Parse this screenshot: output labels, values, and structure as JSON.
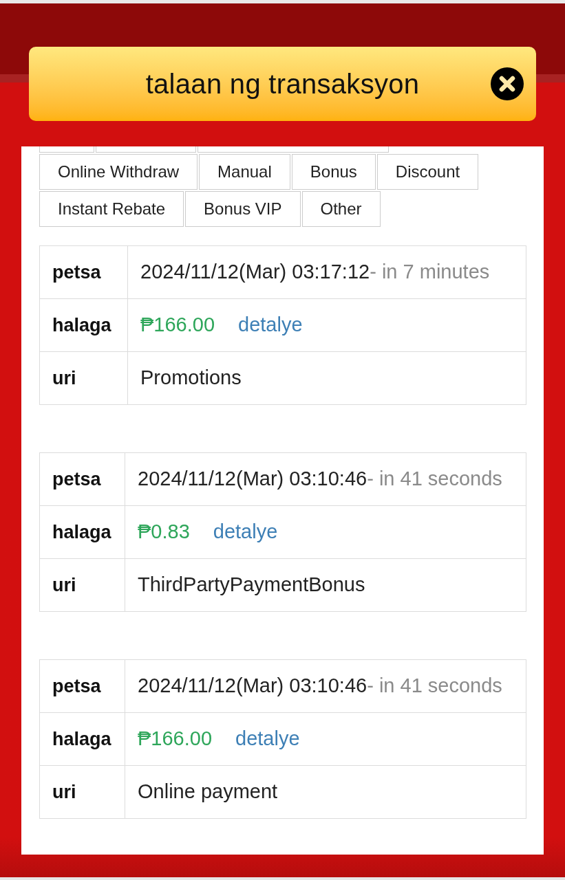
{
  "dialog": {
    "title": "talaan ng transaksyon"
  },
  "tabs": [
    {
      "label": "Online Withdraw"
    },
    {
      "label": "Manual"
    },
    {
      "label": "Bonus"
    },
    {
      "label": "Discount"
    },
    {
      "label": "Instant Rebate"
    },
    {
      "label": "Bonus VIP"
    },
    {
      "label": "Other"
    }
  ],
  "transactions": [
    {
      "date_label": "petsa",
      "date": "2024/11/12(Mar) 03:17:12",
      "relative_time": "- in 7 minutes",
      "amount_label": "halaga",
      "amount": "₱166.00",
      "detail_link": "detalye",
      "type_label": "uri",
      "type": "Promotions"
    },
    {
      "date_label": "petsa",
      "date": "2024/11/12(Mar) 03:10:46",
      "relative_time": "- in 41 seconds",
      "amount_label": "halaga",
      "amount": "₱0.83",
      "detail_link": "detalye",
      "type_label": "uri",
      "type": "ThirdPartyPaymentBonus"
    },
    {
      "date_label": "petsa",
      "date": "2024/11/12(Mar) 03:10:46",
      "relative_time": "- in 41 seconds",
      "amount_label": "halaga",
      "amount": "₱166.00",
      "detail_link": "detalye",
      "type_label": "uri",
      "type": "Online payment"
    }
  ]
}
